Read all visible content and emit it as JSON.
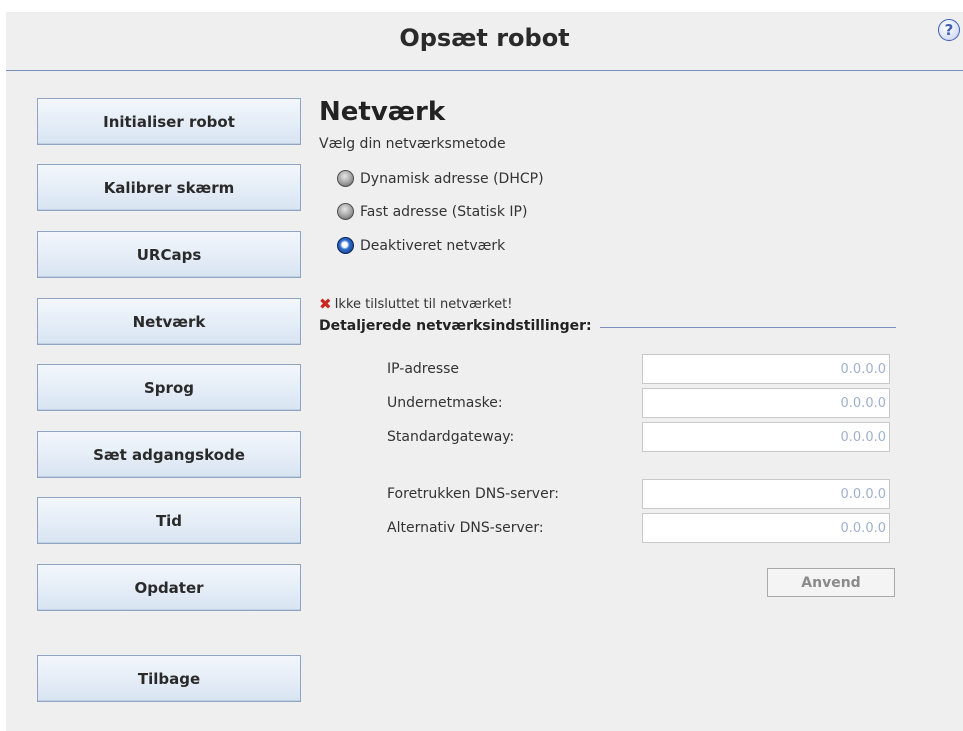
{
  "header": {
    "title": "Opsæt robot",
    "help_icon": "?"
  },
  "nav": {
    "items": [
      {
        "label": "Initialiser robot"
      },
      {
        "label": "Kalibrer skærm"
      },
      {
        "label": "URCaps"
      },
      {
        "label": "Netværk"
      },
      {
        "label": "Sprog"
      },
      {
        "label": "Sæt adgangskode"
      },
      {
        "label": "Tid"
      },
      {
        "label": "Opdater"
      },
      {
        "label": "Tilbage"
      }
    ]
  },
  "network": {
    "title": "Netværk",
    "method_label": "Vælg din netværksmetode",
    "methods": [
      {
        "label": "Dynamisk adresse (DHCP)",
        "selected": false
      },
      {
        "label": "Fast adresse (Statisk IP)",
        "selected": false
      },
      {
        "label": "Deaktiveret netværk",
        "selected": true
      }
    ],
    "status_icon": "✖",
    "status_text": "Ikke tilsluttet til netværket!",
    "details_label": "Detaljerede netværksindstillinger:",
    "fields": [
      {
        "label": "IP-adresse",
        "value": "0.0.0.0"
      },
      {
        "label": "Undernetmaske:",
        "value": "0.0.0.0"
      },
      {
        "label": "Standardgateway:",
        "value": "0.0.0.0"
      },
      {
        "label": "Foretrukken DNS-server:",
        "value": "0.0.0.0"
      },
      {
        "label": "Alternativ DNS-server:",
        "value": "0.0.0.0"
      }
    ],
    "apply_label": "Anvend"
  },
  "colors": {
    "accent_line": "#7a8bbd",
    "button_gradient_top": "#f3f7fc",
    "button_gradient_bottom": "#d8e4f2",
    "status_error": "#c9281e",
    "input_text": "#9fb0cf",
    "radio_selected": "#2f6fd0"
  }
}
